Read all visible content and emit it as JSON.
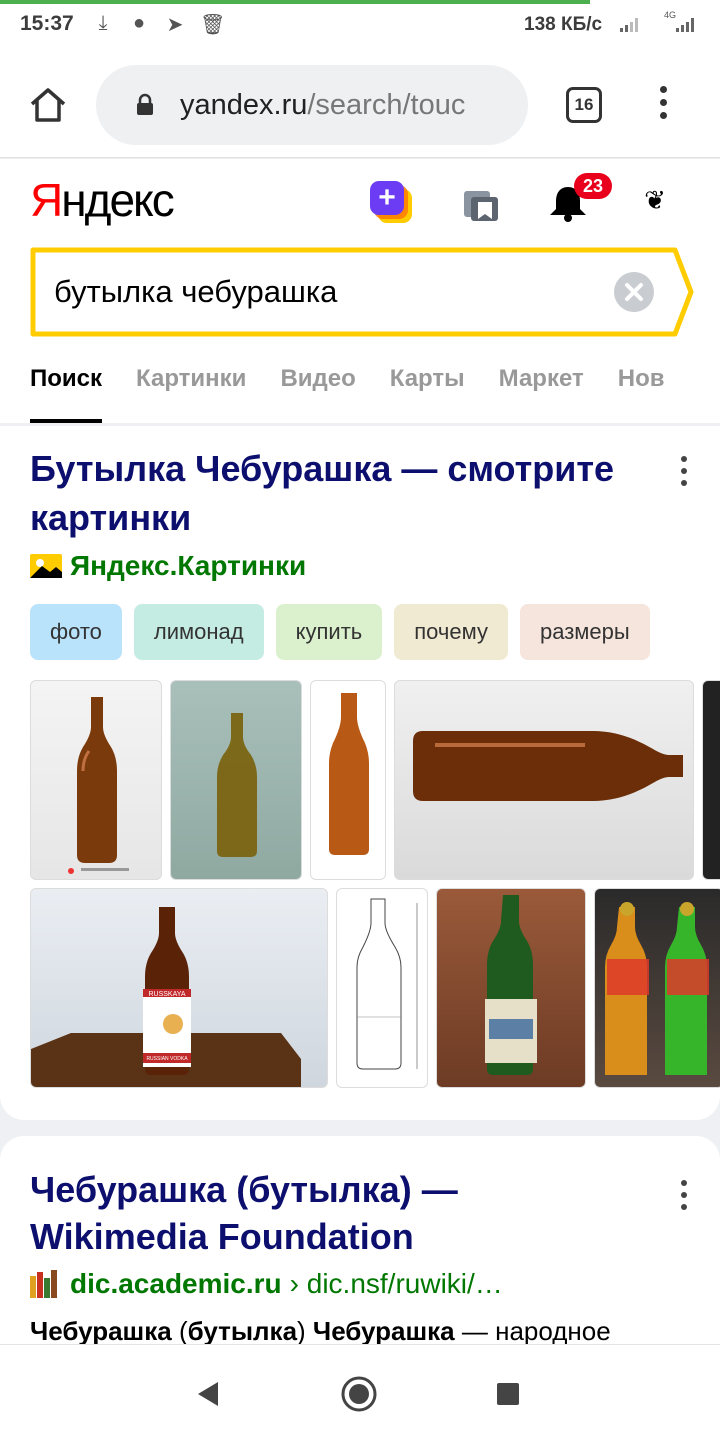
{
  "status_bar": {
    "time": "15:37",
    "speed": "138 КБ/с",
    "network": "4G",
    "icons": [
      "download-icon",
      "chat-icon",
      "telegram-icon",
      "trash-icon",
      "signal-icon",
      "signal-4g-icon"
    ]
  },
  "browser": {
    "url_main": "yandex.ru",
    "url_rest": "/search/touc",
    "tabs_count": "16"
  },
  "header": {
    "logo_first": "Я",
    "logo_rest": "ндекс",
    "notifications_count": "23",
    "plus_label": "+"
  },
  "search": {
    "query": "бутылка чебурашка"
  },
  "tabs": [
    "Поиск",
    "Картинки",
    "Видео",
    "Карты",
    "Маркет",
    "Нов"
  ],
  "active_tab": "Поиск",
  "result1": {
    "title": "Бутылка Чебурашка — смотрите картинки",
    "source": "Яндекс.Картинки",
    "chips": [
      {
        "label": "фото",
        "color": "#b9e3fb"
      },
      {
        "label": "лимонад",
        "color": "#c4ece2"
      },
      {
        "label": "купить",
        "color": "#dbf1cd"
      },
      {
        "label": "почему",
        "color": "#f1ead3"
      },
      {
        "label": "размеры",
        "color": "#f5e5dc"
      }
    ],
    "thumb_labels": {
      "vodka_band": "RUSSKAYA",
      "vodka_label": "RUSSIAN VODKA"
    }
  },
  "result2": {
    "title": "Чебурашка (бутылка) — Wikimedia Foundation",
    "domain": "dic.academic.ru",
    "path": " › dic.nsf/ruwiki/…",
    "snippet_b1": "Чебурашка",
    "snippet_t1": " (",
    "snippet_b2": "бутылка",
    "snippet_t2": ") ",
    "snippet_b3": "Чебурашка",
    "snippet_t3": " — народное"
  },
  "colors": {
    "link": "#0c0f6d",
    "source_green": "#007700",
    "search_border": "#ffcc00",
    "badge_red": "#e8001c",
    "logo_red": "#ff0000"
  }
}
